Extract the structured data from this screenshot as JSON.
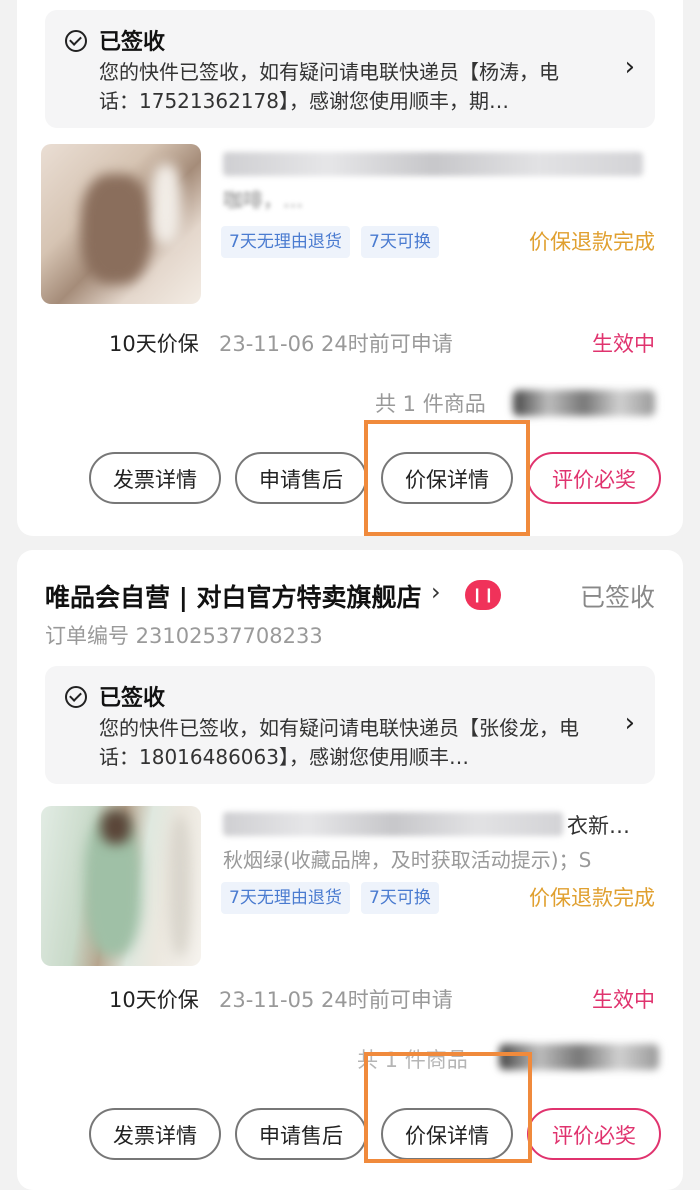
{
  "orders": [
    {
      "delivery": {
        "status": "已签收",
        "message": "您的快件已签收，如有疑问请电联快递员【杨涛，电话：17521362178】，感谢您使用顺丰，期…"
      },
      "product": {
        "subtitle": "咖啡，…",
        "tags": [
          "7天无理由退货",
          "7天可换"
        ],
        "refund_status": "价保退款完成"
      },
      "guarantee": {
        "label": "10天价保",
        "deadline": "23-11-06 24时前可申请",
        "status": "生效中"
      },
      "item_count": "共 1 件商品",
      "buttons": {
        "invoice": "发票详情",
        "after_sale": "申请售后",
        "price_protect": "价保详情",
        "review": "评价必奖"
      }
    },
    {
      "shop_name": "唯品会自营 | 对白官方特卖旗舰店",
      "shop_arrow": "›",
      "order_status": "已签收",
      "order_no": "订单编号 23102537708233",
      "delivery": {
        "status": "已签收",
        "message": "您的快件已签收，如有疑问请电联快递员【张俊龙，电话：18016486063】，感谢您使用顺丰…"
      },
      "product": {
        "title_tail": "衣新…",
        "subtitle": "秋烟绿(收藏品牌，及时获取活动提示)；S",
        "tags": [
          "7天无理由退货",
          "7天可换"
        ],
        "refund_status": "价保退款完成"
      },
      "guarantee": {
        "label": "10天价保",
        "deadline": "23-11-05 24时前可申请",
        "status": "生效中"
      },
      "item_count": "共 1 件商品",
      "buttons": {
        "invoice": "发票详情",
        "after_sale": "申请售后",
        "price_protect": "价保详情",
        "review": "评价必奖"
      }
    }
  ],
  "colors": {
    "accent_pink": "#e0336e",
    "refund_orange": "#e0a030",
    "highlight_orange": "#f08a3c",
    "tag_blue": "#4a7bd0"
  }
}
